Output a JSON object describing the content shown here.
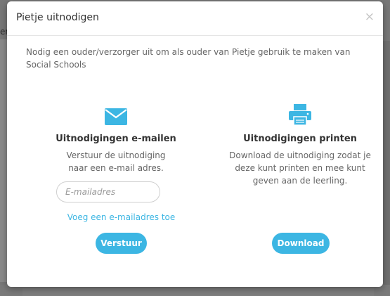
{
  "modal": {
    "title": "Pietje uitnodigen",
    "close_label": "×",
    "intro": "Nodig een ouder/verzorger uit om als ouder van Pietje gebruik te maken van Social Schools"
  },
  "email_section": {
    "icon": "envelope-icon",
    "title": "Uitnodigingen e-mailen",
    "description": "Verstuur de uitnodiging naar een e-mail adres.",
    "input_placeholder": "E-mailadres",
    "input_value": "",
    "add_link": "Voeg een e-mailadres toe",
    "send_label": "Verstuur"
  },
  "print_section": {
    "icon": "printer-icon",
    "title": "Uitnodigingen printen",
    "description": "Download de uitnodiging zodat je deze kunt printen en mee kunt geven aan de leerling.",
    "download_label": "Download"
  },
  "colors": {
    "accent": "#3cb6e3",
    "overlay": "#7d7d7d",
    "text": "#333333",
    "muted": "#666666"
  }
}
